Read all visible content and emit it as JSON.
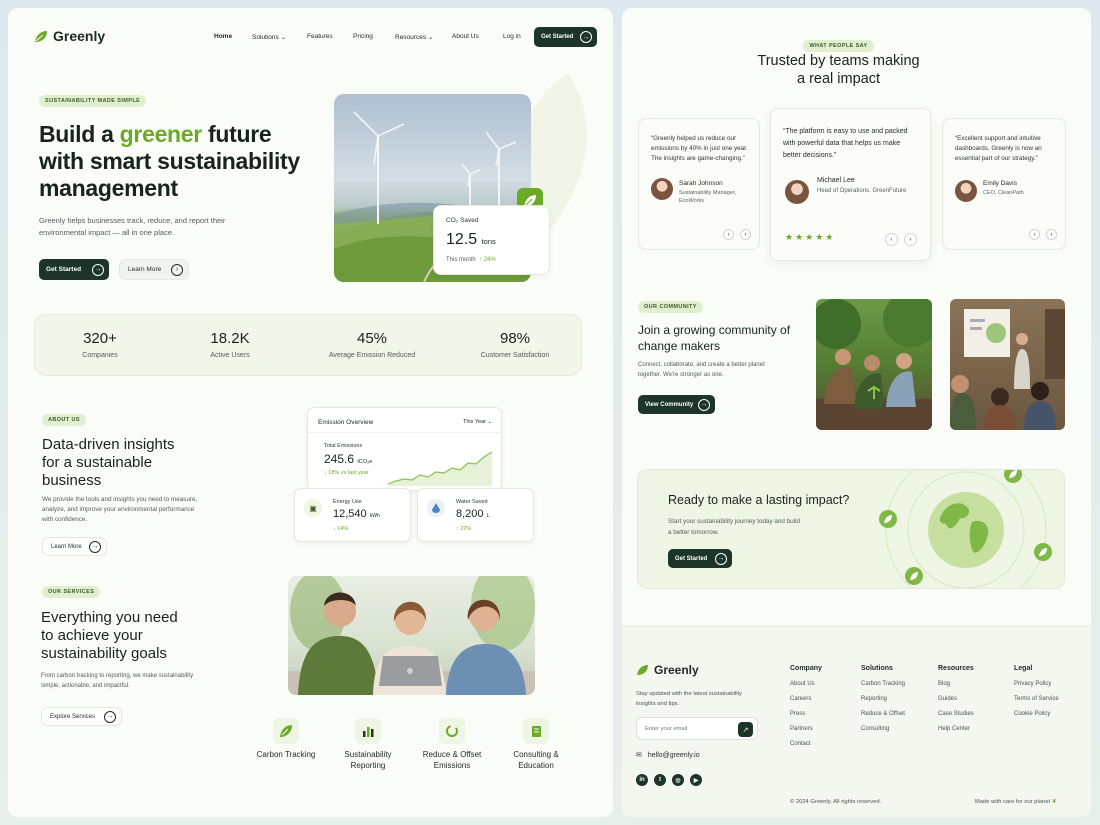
{
  "brand": {
    "name": "Greenly"
  },
  "nav": {
    "home": "Home",
    "solutions": "Solutions",
    "features": "Features",
    "pricing": "Pricing",
    "resources": "Resources",
    "about": "About Us",
    "login": "Log in",
    "cta": "Get Started"
  },
  "hero": {
    "badge": "SUSTAINABILITY MADE SIMPLE",
    "title_pre": "Build a ",
    "title_accent": "greener",
    "title_post": " future with smart sustainability management",
    "subtitle": "Greenly helps businesses track, reduce, and report their environmental impact — all in one place.",
    "primary": "Get Started",
    "secondary": "Learn More",
    "co2": {
      "label": "CO₂ Saved",
      "value": "12.5",
      "unit": "tons",
      "period": "This month",
      "change": "24%"
    }
  },
  "stats": [
    {
      "value": "320+",
      "label": "Companies"
    },
    {
      "value": "18.2K",
      "label": "Active Users"
    },
    {
      "value": "45%",
      "label": "Average Emission Reduced"
    },
    {
      "value": "98%",
      "label": "Customer Satisfaction"
    }
  ],
  "about": {
    "badge": "ABOUT US",
    "title": "Data-driven insights for a sustainable business",
    "text": "We provide the tools and insights you need to measure, analyze, and improve your environmental performance with confidence.",
    "button": "Learn More"
  },
  "emission": {
    "title": "Emission Overview",
    "period": "This Year",
    "total_label": "Total Emissions",
    "total_value": "245.6",
    "total_unit": "tCO₂e",
    "change": "18% vs last year",
    "energy": {
      "label": "Energy Use",
      "value": "12,540",
      "unit": "kWh",
      "change": "14%"
    },
    "water": {
      "label": "Water Saved",
      "value": "8,200",
      "unit": "L",
      "change": "22%"
    }
  },
  "services": {
    "badge": "OUR SERVICES",
    "title": "Everything you need to achieve your sustainability goals",
    "text": "From carbon tracking to reporting, we make sustainability simple, actionable, and impactful.",
    "button": "Explore Services",
    "items": [
      {
        "label": "Carbon Tracking",
        "icon": "leaf-icon"
      },
      {
        "label": "Sustainability Reporting",
        "icon": "bar-chart-icon"
      },
      {
        "label": "Reduce & Offset Emissions",
        "icon": "cycle-icon"
      },
      {
        "label": "Consulting & Education",
        "icon": "document-icon"
      }
    ]
  },
  "testimonials": {
    "badge": "WHAT PEOPLE SAY",
    "title": "Trusted by teams making a real impact",
    "items": [
      {
        "quote": "“Greenly helped us reduce our emissions by 40% in just one year. The insights are game-changing.”",
        "name": "Sarah Johnson",
        "role": "Sustainability Manager, EcoWorks"
      },
      {
        "quote": "“The platform is easy to use and packed with powerful data that helps us make better decisions.”",
        "name": "Michael Lee",
        "role": "Head of Operations, GreenFuture",
        "stars": 5
      },
      {
        "quote": "“Excellent support and intuitive dashboards. Greenly is now an essential part of our strategy.”",
        "name": "Emily Davis",
        "role": "CEO, CleanPath"
      }
    ]
  },
  "community": {
    "badge": "OUR COMMUNITY",
    "title": "Join a growing community of change makers",
    "text": "Connect, collaborate, and create a better planet together. We're stronger as one.",
    "button": "View Community"
  },
  "cta": {
    "title": "Ready to make a lasting impact?",
    "text": "Start your sustainability journey today and build a better tomorrow.",
    "button": "Get Started"
  },
  "footer": {
    "tagline": "Stay updated with the latest sustainability insights and tips.",
    "email_placeholder": "Enter your email",
    "email": "hello@greenly.io",
    "copyright": "© 2024 Greenly. All rights reserved.",
    "made": "Made with care for our planet",
    "columns": [
      {
        "title": "Company",
        "links": [
          "About Us",
          "Careers",
          "Press",
          "Partners",
          "Contact"
        ]
      },
      {
        "title": "Solutions",
        "links": [
          "Carbon Tracking",
          "Reporting",
          "Reduce & Offset",
          "Consulting"
        ]
      },
      {
        "title": "Resources",
        "links": [
          "Blog",
          "Guides",
          "Case Studies",
          "Help Center"
        ]
      },
      {
        "title": "Legal",
        "links": [
          "Privacy Policy",
          "Terms of Service",
          "Cookie Policy"
        ]
      }
    ],
    "social": [
      "linkedin",
      "twitter",
      "instagram",
      "youtube"
    ]
  },
  "colors": {
    "accent": "#6aaa27",
    "dark": "#1c3528",
    "badge_bg": "#e0efcf"
  }
}
